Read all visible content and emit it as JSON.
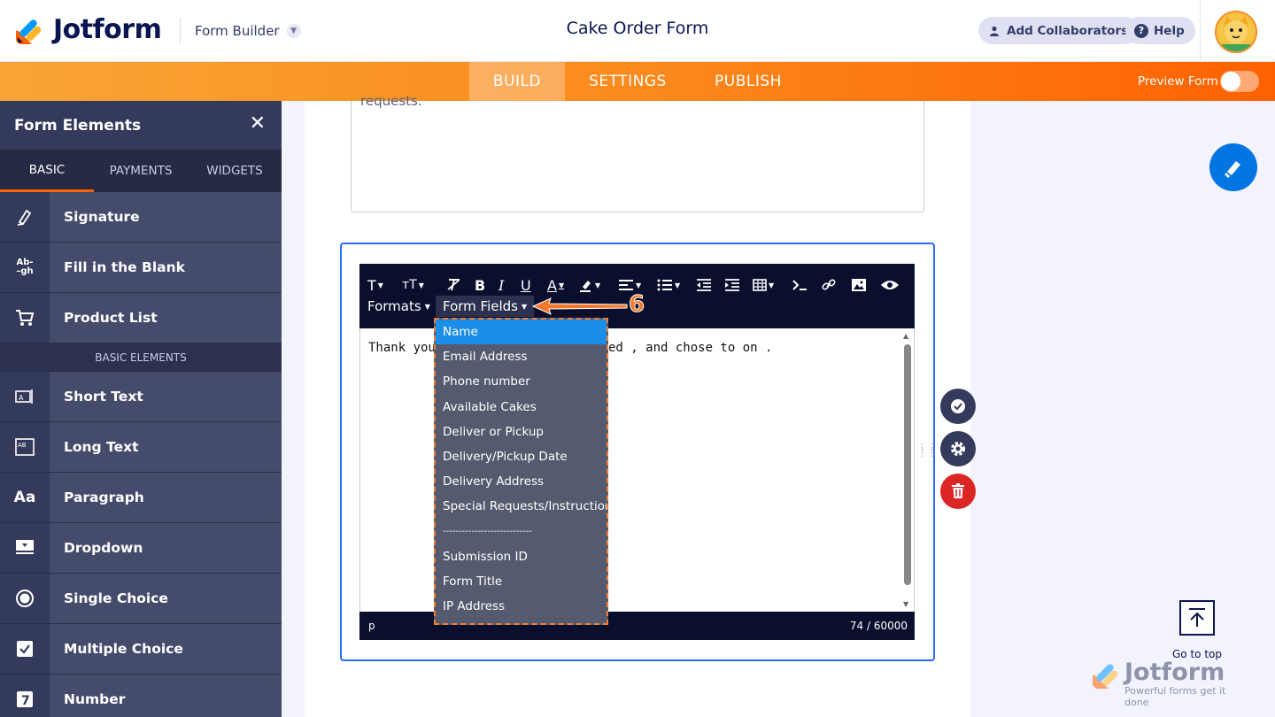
{
  "header": {
    "brand": "Jotform",
    "mode_label": "Form Builder",
    "form_title": "Cake Order Form",
    "add_collaborators": "Add Collaborators",
    "help": "Help"
  },
  "navbar": {
    "tabs": [
      "BUILD",
      "SETTINGS",
      "PUBLISH"
    ],
    "active_tab": "BUILD",
    "preview_label": "Preview Form",
    "preview_enabled": false
  },
  "sidebar": {
    "title": "Form Elements",
    "tabs": [
      "BASIC",
      "PAYMENTS",
      "WIDGETS"
    ],
    "active_tab": "BASIC",
    "top_items": [
      {
        "label": "Signature",
        "icon": "signature-icon"
      },
      {
        "label": "Fill in the Blank",
        "icon": "fill-blank-icon"
      },
      {
        "label": "Product List",
        "icon": "cart-icon"
      }
    ],
    "section_label": "BASIC ELEMENTS",
    "items": [
      {
        "label": "Short Text",
        "icon": "short-text-icon"
      },
      {
        "label": "Long Text",
        "icon": "long-text-icon"
      },
      {
        "label": "Paragraph",
        "icon": "paragraph-icon"
      },
      {
        "label": "Dropdown",
        "icon": "dropdown-icon"
      },
      {
        "label": "Single Choice",
        "icon": "radio-icon"
      },
      {
        "label": "Multiple Choice",
        "icon": "checkbox-icon"
      },
      {
        "label": "Number",
        "icon": "number-icon"
      }
    ]
  },
  "form": {
    "textarea_tail": "requests."
  },
  "editor": {
    "toolbar_row2": {
      "formats": "Formats",
      "form_fields": "Form Fields"
    },
    "text_before": "Thank you,",
    "text_after": "ed , and chose to  on .",
    "status_tag": "p",
    "char_count": "74 / 60000"
  },
  "dropdown": {
    "items": [
      "Name",
      "Email Address",
      "Phone number",
      "Available Cakes",
      "Deliver or Pickup",
      "Delivery/Pickup Date",
      "Delivery Address",
      "Special Requests/Instructions",
      "----------------------------",
      "Submission ID",
      "Form Title",
      "IP Address"
    ],
    "selected": "Name"
  },
  "annotation": {
    "step": "6"
  },
  "go_to_top": "Go to top",
  "watermark": {
    "brand": "Jotform",
    "tagline": "Powerful forms get it done"
  },
  "colors": {
    "accent": "#ff6100",
    "primary_blue": "#0075e3",
    "danger": "#dc2626",
    "sidebar": "#2f3453"
  }
}
